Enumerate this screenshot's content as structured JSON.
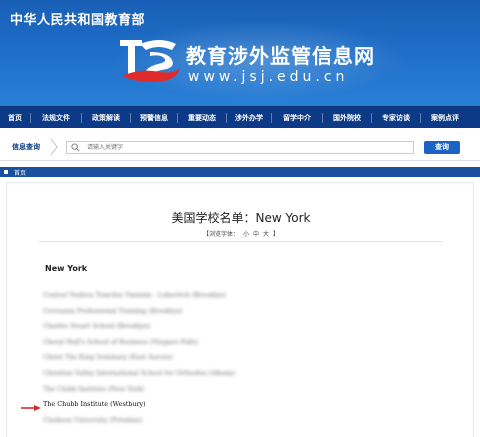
{
  "header": {
    "ministry": "中华人民共和国教育部",
    "site_title": "教育涉外监管信息网",
    "site_url": "www.jsj.edu.cn",
    "logo_letters": "JS"
  },
  "nav": {
    "items": [
      "首页",
      "法规文件",
      "政策解读",
      "预警信息",
      "重要动态",
      "涉外办学",
      "留学中介",
      "国外院校",
      "专家访谈",
      "案例点评"
    ]
  },
  "search": {
    "label": "信息查询",
    "placeholder": "请输入关键字",
    "button": "查询"
  },
  "breadcrumb": {
    "home": "首页"
  },
  "article": {
    "title": "美国学校名单：New York",
    "font_size_label": "【浏览字体：",
    "font_size_options": [
      "小",
      "中",
      "大"
    ],
    "font_size_close": "】",
    "state_heading": "New York",
    "schools": [
      "Central Yeshiva Tomchei Tmimim - Lubavitch (Brooklyn)",
      "Cerrasian Professional Training (Brooklyn)",
      "Charles Stuart School (Brooklyn)",
      "Cheryl Hall's School of Business (Niagara Falls)",
      "Christ The King Seminary (East Aurora)",
      "Christian Valley International School for Orthodox (Albany)",
      "The Clubb Institute (New York)",
      "The Chubb Institute (Westbury)",
      "Clarkson University (Potsdam)"
    ],
    "highlighted_index": 7
  },
  "colors": {
    "banner_blue": "#1d6dc6",
    "nav_navy": "#0c3a87",
    "button_blue": "#1a63c4",
    "arrow_red": "#d92b2b"
  }
}
